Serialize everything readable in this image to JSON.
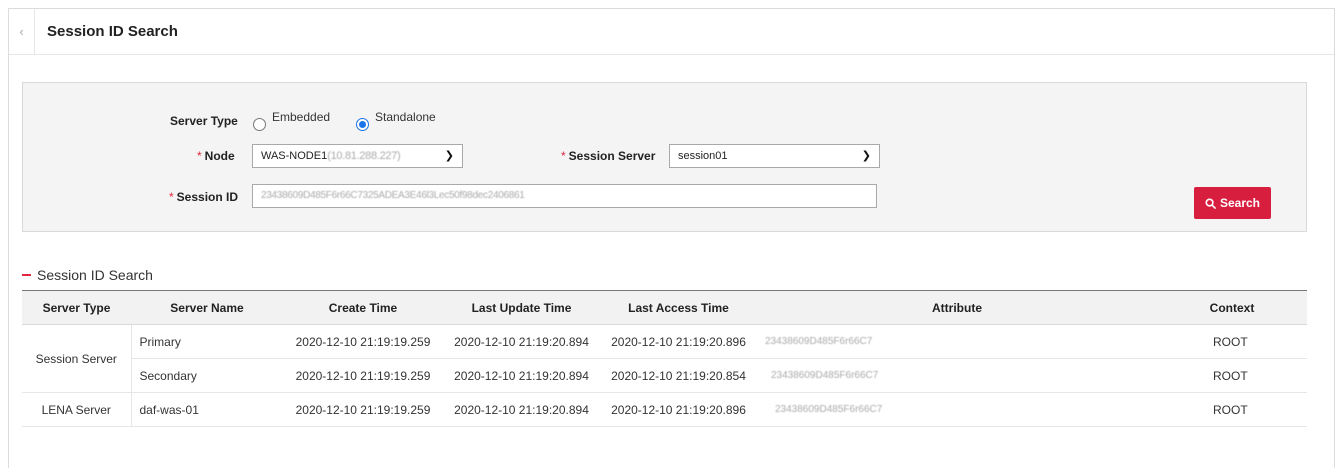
{
  "header": {
    "collapse_icon": "chevron-left-icon",
    "title": "Session ID Search"
  },
  "form": {
    "server_type_label": "Server Type",
    "server_type_options": [
      "Embedded",
      "Standalone"
    ],
    "server_type_selected": "Standalone",
    "node_label": "Node",
    "node_value": "WAS-NODE1",
    "node_value_obscured": "(10.81.288.227)",
    "session_server_label": "Session Server",
    "session_server_value": "session01",
    "session_id_label": "Session ID",
    "session_id_value": "23438609D485F6r66C7325ADEA3E46l3Lec50f98dec2406861",
    "required_mark": "*",
    "search_button": "Search",
    "search_icon": "search-icon"
  },
  "results": {
    "title": "Session ID Search",
    "columns": [
      "Server Type",
      "Server Name",
      "Create Time",
      "Last Update Time",
      "Last Access Time",
      "Attribute",
      "Context"
    ],
    "rows": [
      {
        "server_type": "Session Server",
        "server_name": "Primary",
        "create_time": "2020-12-10 21:19:19.259",
        "last_update_time": "2020-12-10 21:19:20.894",
        "last_access_time": "2020-12-10 21:19:20.896",
        "attribute": "23438609D485F6r66C7",
        "context": "ROOT"
      },
      {
        "server_type": "",
        "server_name": "Secondary",
        "create_time": "2020-12-10 21:19:19.259",
        "last_update_time": "2020-12-10 21:19:20.894",
        "last_access_time": "2020-12-10 21:19:20.854",
        "attribute": "23438609D485F6r66C7",
        "context": "ROOT"
      },
      {
        "server_type": "LENA Server",
        "server_name": "daf-was-01",
        "create_time": "2020-12-10 21:19:19.259",
        "last_update_time": "2020-12-10 21:19:20.894",
        "last_access_time": "2020-12-10 21:19:20.896",
        "attribute": "23438609D485F6r66C7",
        "context": "ROOT"
      }
    ]
  },
  "colors": {
    "accent": "#d81e3f",
    "radio_selected": "#1a73e8",
    "required": "#e2263e"
  }
}
